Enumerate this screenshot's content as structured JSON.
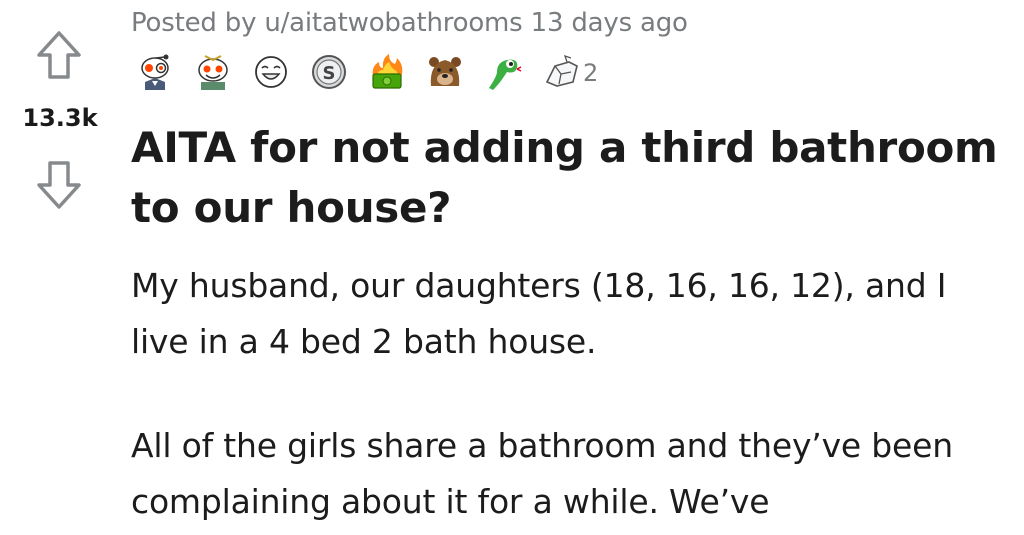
{
  "post": {
    "posted_by_prefix": "Posted by ",
    "username": "u/aitatwobathrooms",
    "time_ago": " 13 days ago",
    "vote_count": "13.3k",
    "title": "AITA for not adding a third bathroom to our house?",
    "awards": {
      "icons": [
        "snoo-monocle-award-icon",
        "snoo-party-award-icon",
        "grin-face-award-icon",
        "silver-coin-award-icon",
        "flaming-money-award-icon",
        "bear-face-award-icon",
        "green-snake-award-icon",
        "hand-pointer-award-icon"
      ],
      "extra_count": "2"
    },
    "body": [
      "My husband, our daughters (18, 16, 16, 12), and I live in a 4 bed 2 bath house.",
      "All of the girls share a bathroom and they’ve been complaining about it for a while. We’ve"
    ]
  },
  "colors": {
    "meta_text": "#787c7e",
    "title_text": "#1c1c1c",
    "vote_icon": "#878a8c"
  }
}
